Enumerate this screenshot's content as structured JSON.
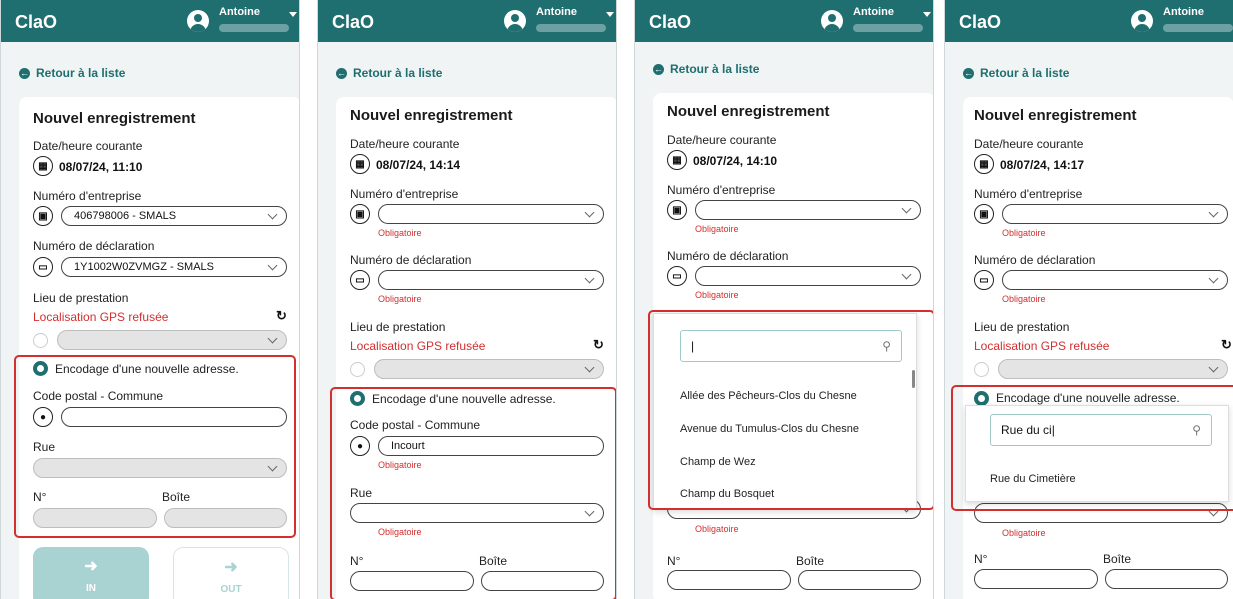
{
  "app": {
    "title": "ClaO",
    "user": "Antoine"
  },
  "nav": {
    "back": "Retour à la liste"
  },
  "form": {
    "title": "Nouvel enregistrement",
    "date_label": "Date/heure courante",
    "company_label": "Numéro d'entreprise",
    "declaration_label": "Numéro de déclaration",
    "place_label": "Lieu de prestation",
    "gps_refused": "Localisation GPS refusée",
    "new_address_label": "Encodage d'une nouvelle adresse.",
    "postal_label": "Code postal - Commune",
    "street_label": "Rue",
    "number_label": "N°",
    "box_label": "Boîte",
    "required": "Obligatoire",
    "in_label": "IN",
    "out_label": "OUT"
  },
  "screens": [
    {
      "datetime": "08/07/24, 11:10",
      "company_value": "406798006 - SMALS",
      "declaration_value": "1Y1002W0ZVMGZ - SMALS"
    },
    {
      "datetime": "08/07/24, 14:14",
      "postal_value": "Incourt"
    },
    {
      "datetime": "08/07/24, 14:10",
      "street_options": [
        "Allée des Pêcheurs-Clos du Chesne",
        "Avenue du Tumulus-Clos du Chesne",
        "Champ de Wez",
        "Champ du Bosquet"
      ]
    },
    {
      "datetime": "08/07/24, 14:17",
      "search_value": "Rue du ci",
      "street_options": [
        "Rue du Cimetière"
      ]
    }
  ],
  "colors": {
    "header": "#1f6e70",
    "accent": "#1f6e70",
    "highlight": "#d32f2f",
    "disabled": "#e4e4e4"
  },
  "icons": [
    "user-avatar-icon",
    "caret-down-icon",
    "arrow-left-circle-icon",
    "calendar-icon",
    "building-icon",
    "document-icon",
    "map-pin-icon",
    "refresh-icon",
    "chevron-down-icon",
    "search-icon",
    "sign-in-icon",
    "sign-out-icon"
  ]
}
